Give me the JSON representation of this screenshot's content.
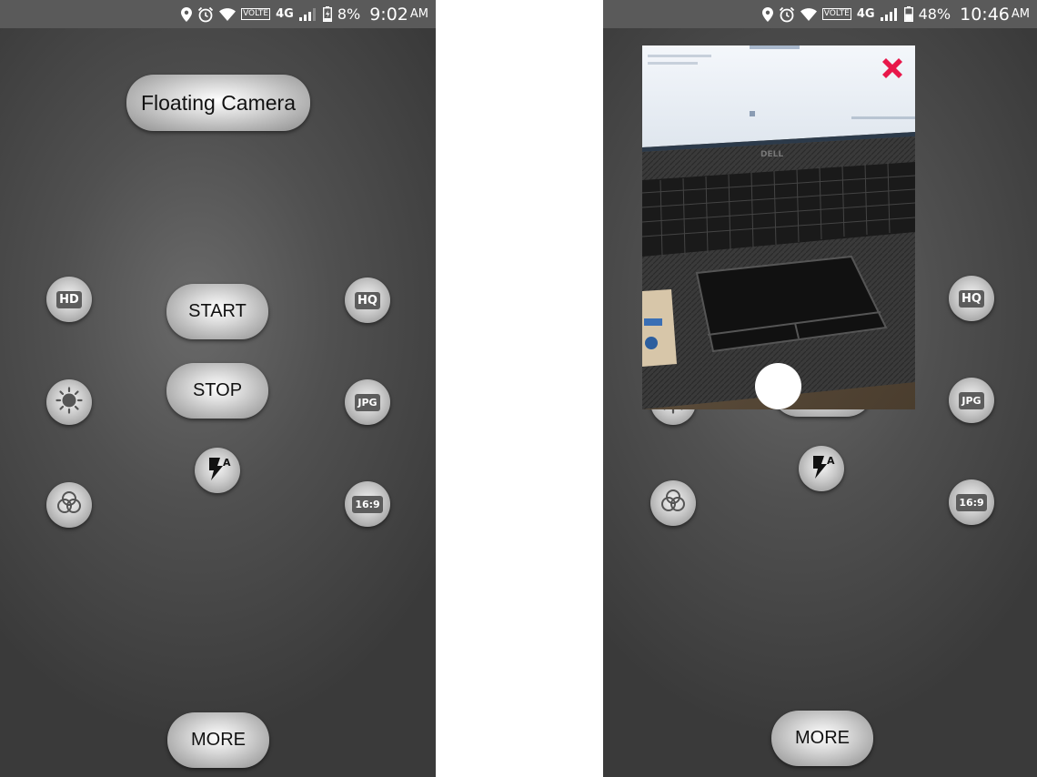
{
  "left_screen": {
    "status": {
      "battery": "8%",
      "time": "9:02",
      "ampm": "AM",
      "volte": "VOLTE",
      "network": "4G"
    },
    "title": "Floating Camera",
    "buttons": {
      "start": "START",
      "stop": "STOP",
      "more": "MORE"
    },
    "left_icons": {
      "hd": "HD"
    },
    "right_icons": {
      "hq": "HQ",
      "jpg": "JPG",
      "ratio": "16:9"
    }
  },
  "right_screen": {
    "status": {
      "battery": "48%",
      "time": "10:46",
      "ampm": "AM",
      "volte": "VOLTE",
      "network": "4G"
    },
    "buttons": {
      "more": "MORE"
    },
    "right_icons": {
      "hq": "HQ",
      "jpg": "JPG",
      "ratio": "16:9"
    },
    "preview": {
      "laptop_brand": "DELL"
    }
  },
  "colors": {
    "close": "#e8174a",
    "tag_bg": "#5c5c5c"
  }
}
